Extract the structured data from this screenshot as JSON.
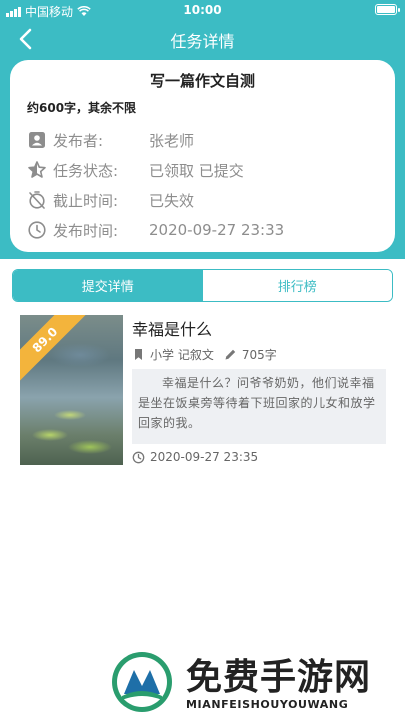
{
  "status_bar": {
    "carrier": "中国移动",
    "time": "10:00"
  },
  "nav": {
    "title": "任务详情"
  },
  "task": {
    "title": "写一篇作文自测",
    "description": "约600字，其余不限",
    "publisher_label": "发布者:",
    "publisher_value": "张老师",
    "status_label": "任务状态:",
    "status_value": "已领取 已提交",
    "deadline_label": "截止时间:",
    "deadline_value": "已失效",
    "publish_time_label": "发布时间:",
    "publish_time_value": "2020-09-27 23:33"
  },
  "tabs": [
    {
      "label": "提交详情",
      "active": true
    },
    {
      "label": "排行榜",
      "active": false
    }
  ],
  "essay": {
    "score": "89.0",
    "title": "幸福是什么",
    "category": "小学 记叙文",
    "word_count": "705字",
    "excerpt": "幸福是什么？问爷爷奶奶，他们说幸福是坐在饭桌旁等待着下班回家的儿女和放学回家的我。",
    "time": "2020-09-27 23:35"
  },
  "watermark": {
    "title": "免费手游网",
    "subtitle": "MIANFEISHOUYOUWANG"
  },
  "colors": {
    "accent": "#3cbcc4",
    "ribbon": "#f3b43c",
    "excerpt_bg": "#eef0f3"
  }
}
